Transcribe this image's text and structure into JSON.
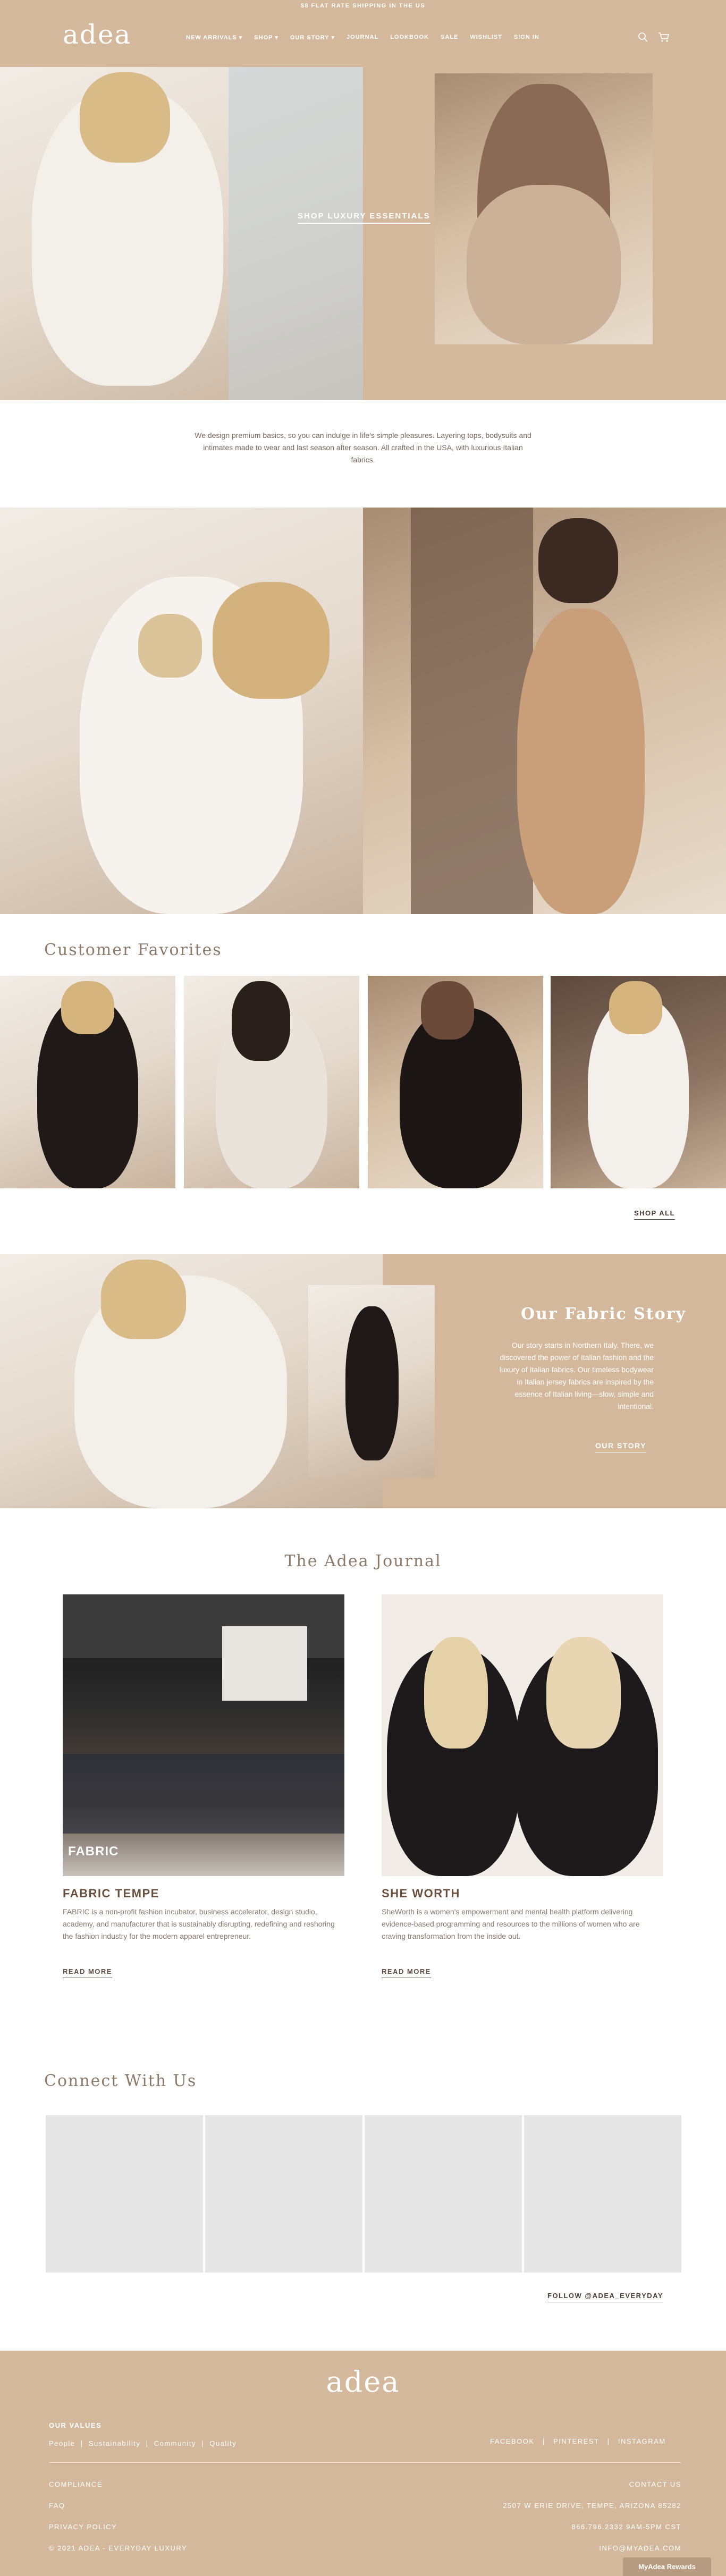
{
  "announcement": "$8 FLAT RATE SHIPPING IN THE US",
  "header": {
    "logo": "adea",
    "nav": [
      {
        "label": "NEW ARRIVALS ▾"
      },
      {
        "label": "SHOP ▾"
      },
      {
        "label": "OUR STORY ▾"
      },
      {
        "label": "JOURNAL"
      },
      {
        "label": "LOOKBOOK"
      },
      {
        "label": "SALE"
      },
      {
        "label": "WISHLIST"
      },
      {
        "label": "SIGN IN"
      }
    ],
    "icons": [
      "search-icon",
      "cart-icon"
    ]
  },
  "hero": {
    "cta": "SHOP LUXURY ESSENTIALS"
  },
  "intro": {
    "text": "We design premium basics, so you can indulge in life's simple pleasures. Layering tops, bodysuits and intimates made to wear and last season after season. All crafted in the USA, with luxurious Italian fabrics."
  },
  "customer_favorites": {
    "title": "Customer Favorites",
    "shop_all": "SHOP ALL"
  },
  "fabric_story": {
    "title": "Our Fabric Story",
    "text": "Our story starts in Northern Italy. There, we discovered the power of Italian fashion and the luxury of Italian fabrics. Our timeless bodywear in Italian jersey fabrics are inspired by the essence of Italian living—slow, simple and intentional.",
    "cta": "OUR STORY"
  },
  "journal": {
    "title": "The Adea Journal",
    "posts": [
      {
        "heading": "FABRIC TEMPE",
        "image_caption": "FABRIC",
        "text": "FABRIC is a non-profit fashion incubator, business accelerator, design studio, academy, and manufacturer that is sustainably disrupting, redefining and reshoring the fashion industry for the modern apparel entrepreneur.",
        "read_more": "READ MORE"
      },
      {
        "heading": "SHE WORTH",
        "text": "SheWorth is a women's empowerment and mental health platform delivering evidence-based programming and resources to the millions of women who are craving transformation from the inside out.",
        "read_more": "READ MORE"
      }
    ]
  },
  "connect": {
    "title": "Connect With Us",
    "follow": "FOLLOW @ADEA_EVERYDAY"
  },
  "footer": {
    "logo": "adea",
    "values_heading": "OUR VALUES",
    "values": "People  |  Sustainability  |  Community  |  Quality",
    "social": "FACEBOOK   |   PINTEREST   |   INSTAGRAM",
    "links": [
      "COMPLIANCE",
      "FAQ",
      "PRIVACY POLICY"
    ],
    "copyright": "© 2021 ADEA - EVERYDAY LUXURY",
    "contact_heading": "CONTACT US",
    "address": "2507 W ERIE DRIVE, TEMPE, ARIZONA 85282",
    "phone": "866.796.2332 9AM-5PM CST",
    "email": "INFO@MYADEA.COM",
    "rewards": "MyAdea Rewards"
  },
  "colors": {
    "brand_tan": "#d3b89c",
    "text_brown": "#6b5a4c"
  }
}
